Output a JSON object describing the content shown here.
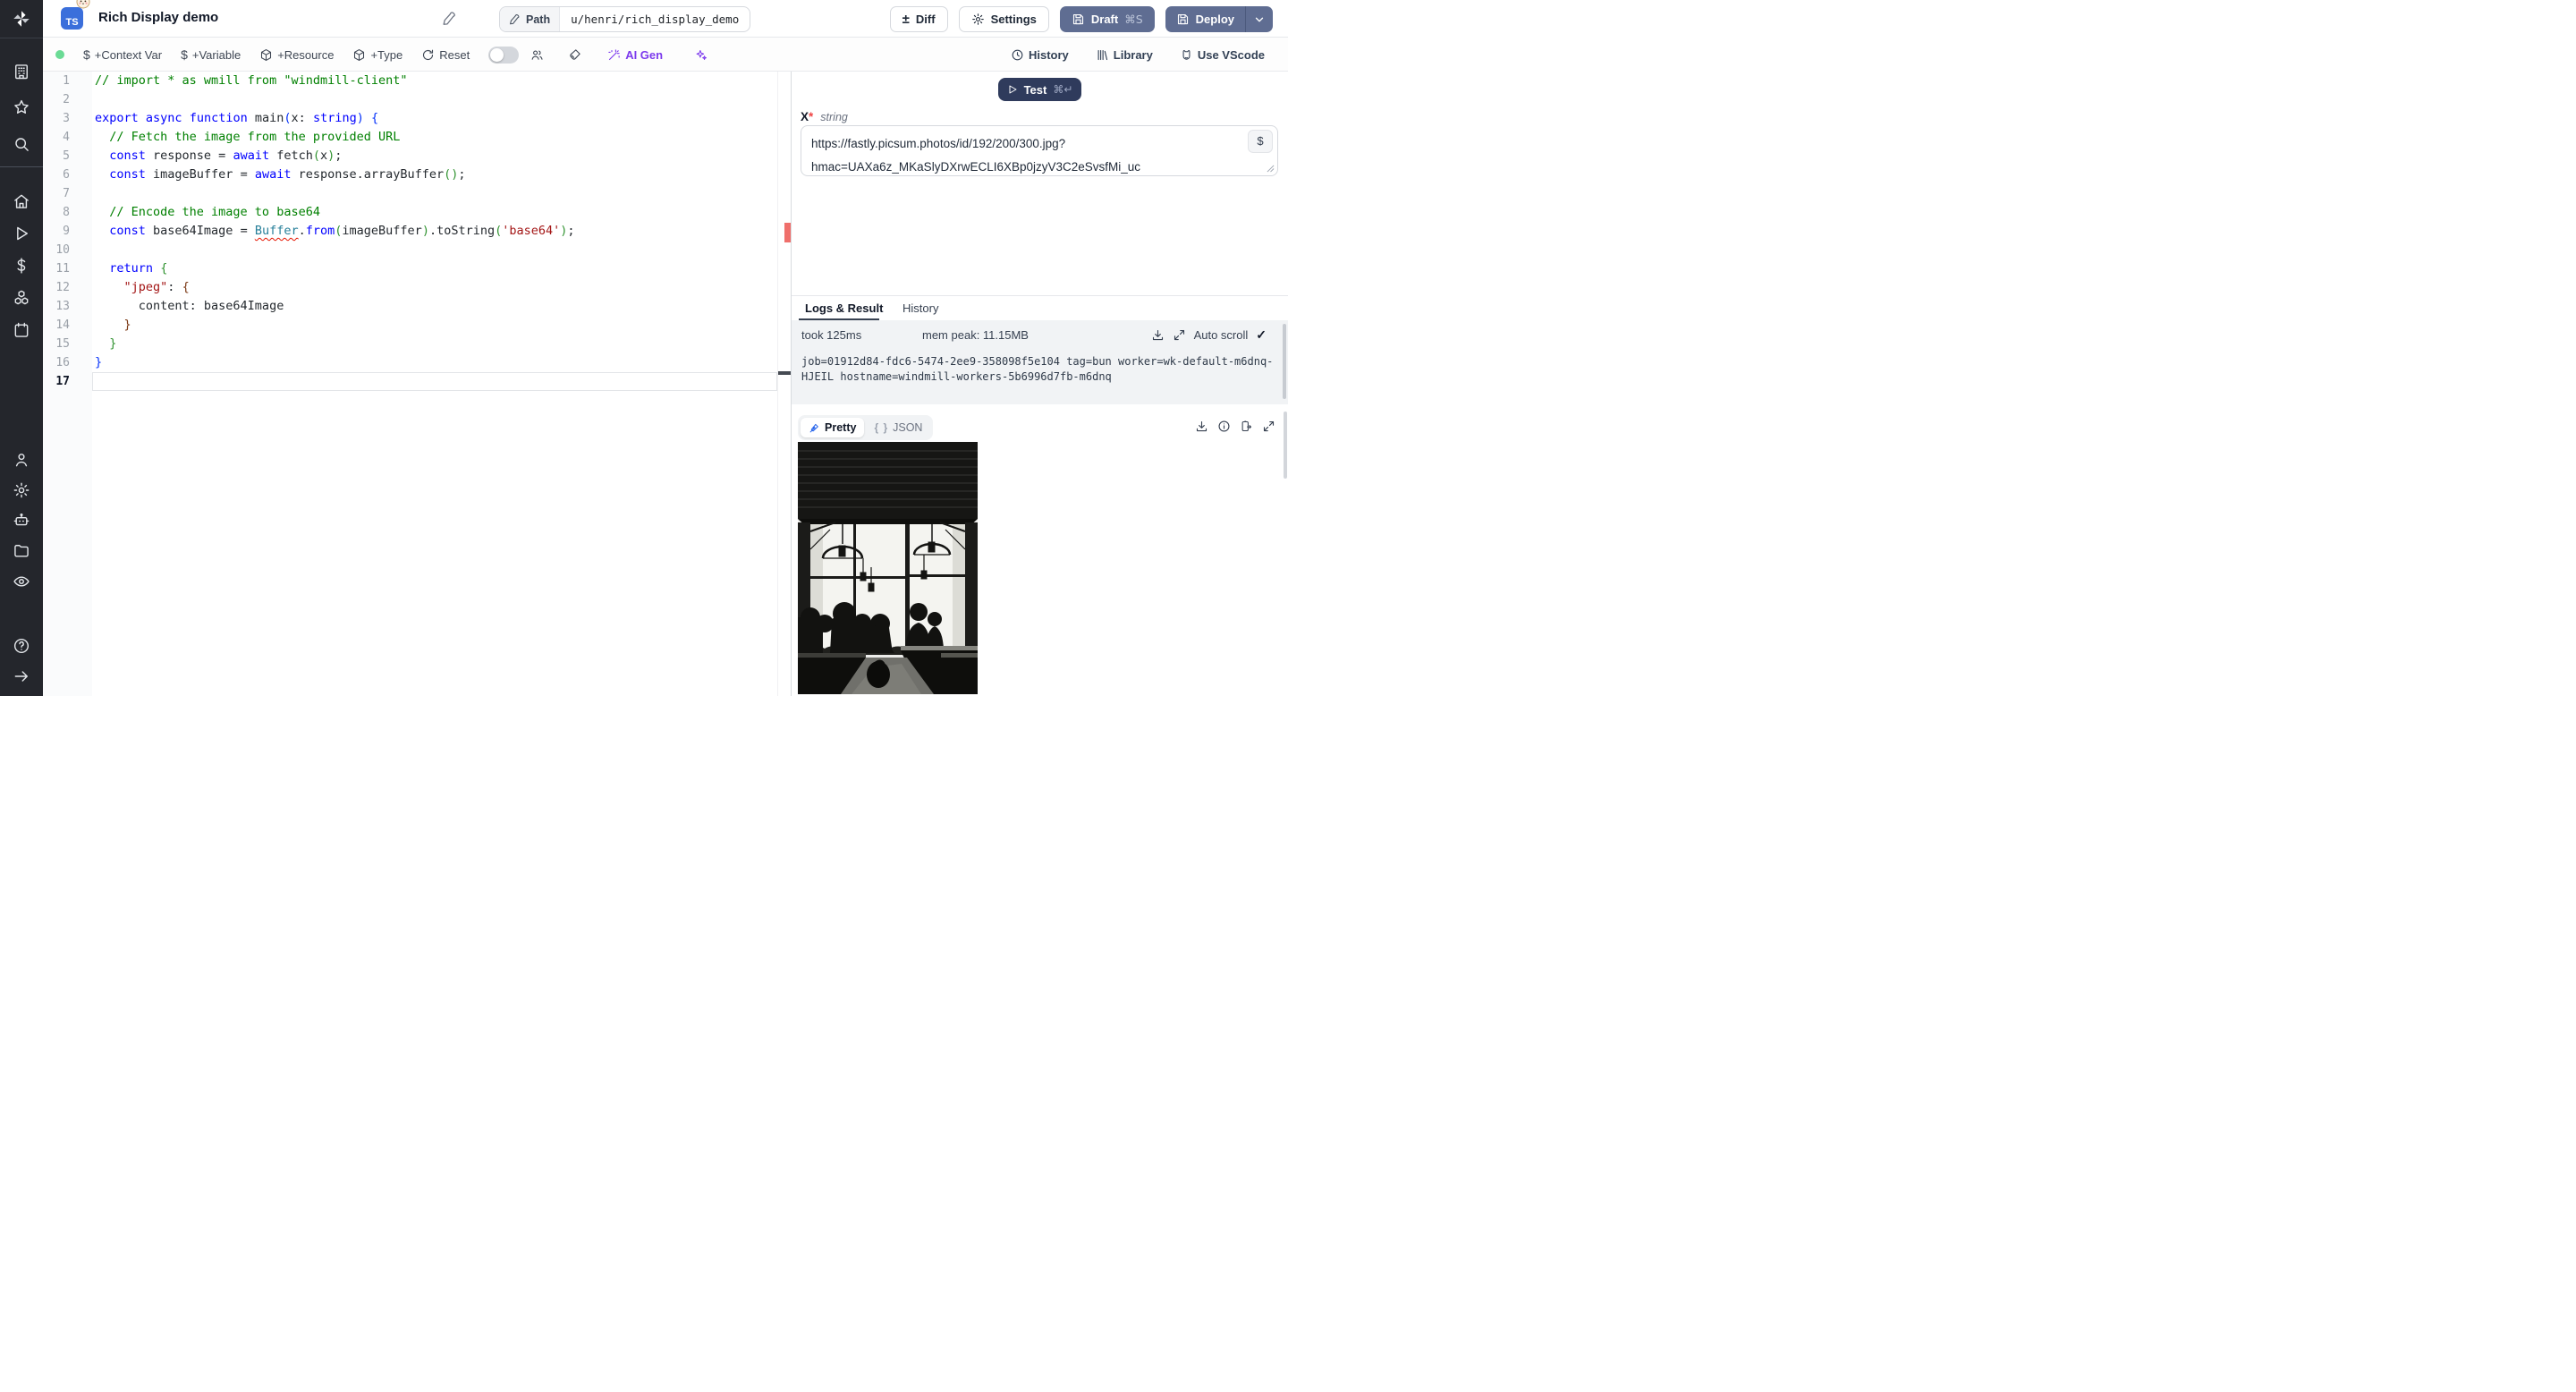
{
  "app": {
    "title": "Rich Display demo",
    "lang_badge": "TS"
  },
  "topbar": {
    "path_label": "Path",
    "path_value": "u/henri/rich_display_demo",
    "diff_label": "Diff",
    "diff_sign": "±",
    "settings_label": "Settings",
    "draft_label": "Draft",
    "draft_kbd": "⌘S",
    "deploy_label": "Deploy"
  },
  "toolbar": {
    "context_var": "+Context Var",
    "variable": "+Variable",
    "resource": "+Resource",
    "type": "+Type",
    "reset": "Reset",
    "ai_gen": "AI Gen",
    "dollar": "$",
    "history": "History",
    "library": "Library",
    "vscode": "Use VScode"
  },
  "sidebar": {
    "icons": [
      "windmill-logo",
      "building",
      "star",
      "search",
      "home",
      "play",
      "dollar",
      "cubes",
      "calendar",
      "user",
      "gear",
      "robot",
      "folder",
      "eye",
      "help",
      "arrow-right"
    ]
  },
  "editor": {
    "current_line": 17,
    "lines": [
      {
        "n": 1,
        "t": [
          [
            "c",
            "// import * as wmill from \"windmill-client\""
          ]
        ]
      },
      {
        "n": 2,
        "t": []
      },
      {
        "n": 3,
        "t": [
          [
            "k",
            "export"
          ],
          [
            "p",
            " "
          ],
          [
            "k",
            "async"
          ],
          [
            "p",
            " "
          ],
          [
            "k",
            "function"
          ],
          [
            "p",
            " "
          ],
          [
            "fn",
            "main"
          ],
          [
            "b1",
            "("
          ],
          [
            "p",
            "x"
          ],
          [
            "p",
            ": "
          ],
          [
            "k",
            "string"
          ],
          [
            "b1",
            ")"
          ],
          [
            "p",
            " "
          ],
          [
            "b1",
            "{"
          ]
        ]
      },
      {
        "n": 4,
        "t": [
          [
            "c",
            "  // Fetch the image from the provided URL"
          ]
        ]
      },
      {
        "n": 5,
        "t": [
          [
            "p",
            "  "
          ],
          [
            "k",
            "const"
          ],
          [
            "p",
            " response = "
          ],
          [
            "k",
            "await"
          ],
          [
            "p",
            " fetch"
          ],
          [
            "b2",
            "("
          ],
          [
            "p",
            "x"
          ],
          [
            "b2",
            ")"
          ],
          [
            "p",
            ";"
          ]
        ]
      },
      {
        "n": 6,
        "t": [
          [
            "p",
            "  "
          ],
          [
            "k",
            "const"
          ],
          [
            "p",
            " imageBuffer = "
          ],
          [
            "k",
            "await"
          ],
          [
            "p",
            " response.arrayBuffer"
          ],
          [
            "b2",
            "()"
          ],
          [
            "p",
            ";"
          ]
        ]
      },
      {
        "n": 7,
        "t": []
      },
      {
        "n": 8,
        "t": [
          [
            "c",
            "  // Encode the image to base64"
          ]
        ]
      },
      {
        "n": 9,
        "t": [
          [
            "p",
            "  "
          ],
          [
            "k",
            "const"
          ],
          [
            "p",
            " base64Image = "
          ],
          [
            "err",
            "Buffer"
          ],
          [
            "p",
            "."
          ],
          [
            "k",
            "from"
          ],
          [
            "b2",
            "("
          ],
          [
            "p",
            "imageBuffer"
          ],
          [
            "b2",
            ")"
          ],
          [
            "p",
            ".toString"
          ],
          [
            "b2",
            "("
          ],
          [
            "s",
            "'base64'"
          ],
          [
            "b2",
            ")"
          ],
          [
            "p",
            ";"
          ]
        ]
      },
      {
        "n": 10,
        "t": []
      },
      {
        "n": 11,
        "t": [
          [
            "p",
            "  "
          ],
          [
            "k",
            "return"
          ],
          [
            "p",
            " "
          ],
          [
            "b2",
            "{"
          ]
        ]
      },
      {
        "n": 12,
        "t": [
          [
            "p",
            "    "
          ],
          [
            "s",
            "\"jpeg\""
          ],
          [
            "p",
            ": "
          ],
          [
            "b3",
            "{"
          ]
        ]
      },
      {
        "n": 13,
        "t": [
          [
            "p",
            "      content: base64Image"
          ]
        ]
      },
      {
        "n": 14,
        "t": [
          [
            "p",
            "    "
          ],
          [
            "b3",
            "}"
          ]
        ]
      },
      {
        "n": 15,
        "t": [
          [
            "p",
            "  "
          ],
          [
            "b2",
            "}"
          ]
        ]
      },
      {
        "n": 16,
        "t": [
          [
            "b1",
            "}"
          ]
        ]
      },
      {
        "n": 17,
        "t": []
      }
    ]
  },
  "runner": {
    "test_label": "Test",
    "test_kbd": "⌘↵",
    "arg_name": "X",
    "arg_required": "*",
    "arg_type": "string",
    "arg_value": "https://fastly.picsum.photos/id/192/200/300.jpg?hmac=UAXa6z_MKaSlyDXrwECLI6XBp0jzyV3C2eSvsfMi_uc",
    "arg_value_line1": "https://fastly.picsum.photos/id/192/200/300.jpg?",
    "arg_value_line2": "hmac=UAXa6z_MKaSlyDXrwECLI6XBp0jzyV3C2eSvsfMi_uc",
    "dollar": "$"
  },
  "result": {
    "tab_logs": "Logs & Result",
    "tab_history": "History",
    "took": "took 125ms",
    "mem_peak": "mem peak: 11.15MB",
    "autoscroll_label": "Auto scroll",
    "autoscroll_check": "✓",
    "log_text": "job=01912d84-fdc6-5474-2ee9-358098f5e104 tag=bun worker=wk-default-m6dnq-HJEIL hostname=windmill-workers-5b6996d7fb-m6dnq",
    "view_pretty": "Pretty",
    "view_json": "JSON",
    "json_braces": "{ }",
    "image_alt": "black and white photo: silhouettes of people at cafe tables in front of large windows"
  },
  "colors": {
    "sidebar_bg": "#24262c",
    "solid_button": "#5f6d92",
    "test_button": "#2f3b5c",
    "accent_purple": "#7c3aed",
    "status_green": "#6bdb95",
    "error_marker": "#ef6f6b",
    "ts_blue": "#3b6fdb"
  }
}
